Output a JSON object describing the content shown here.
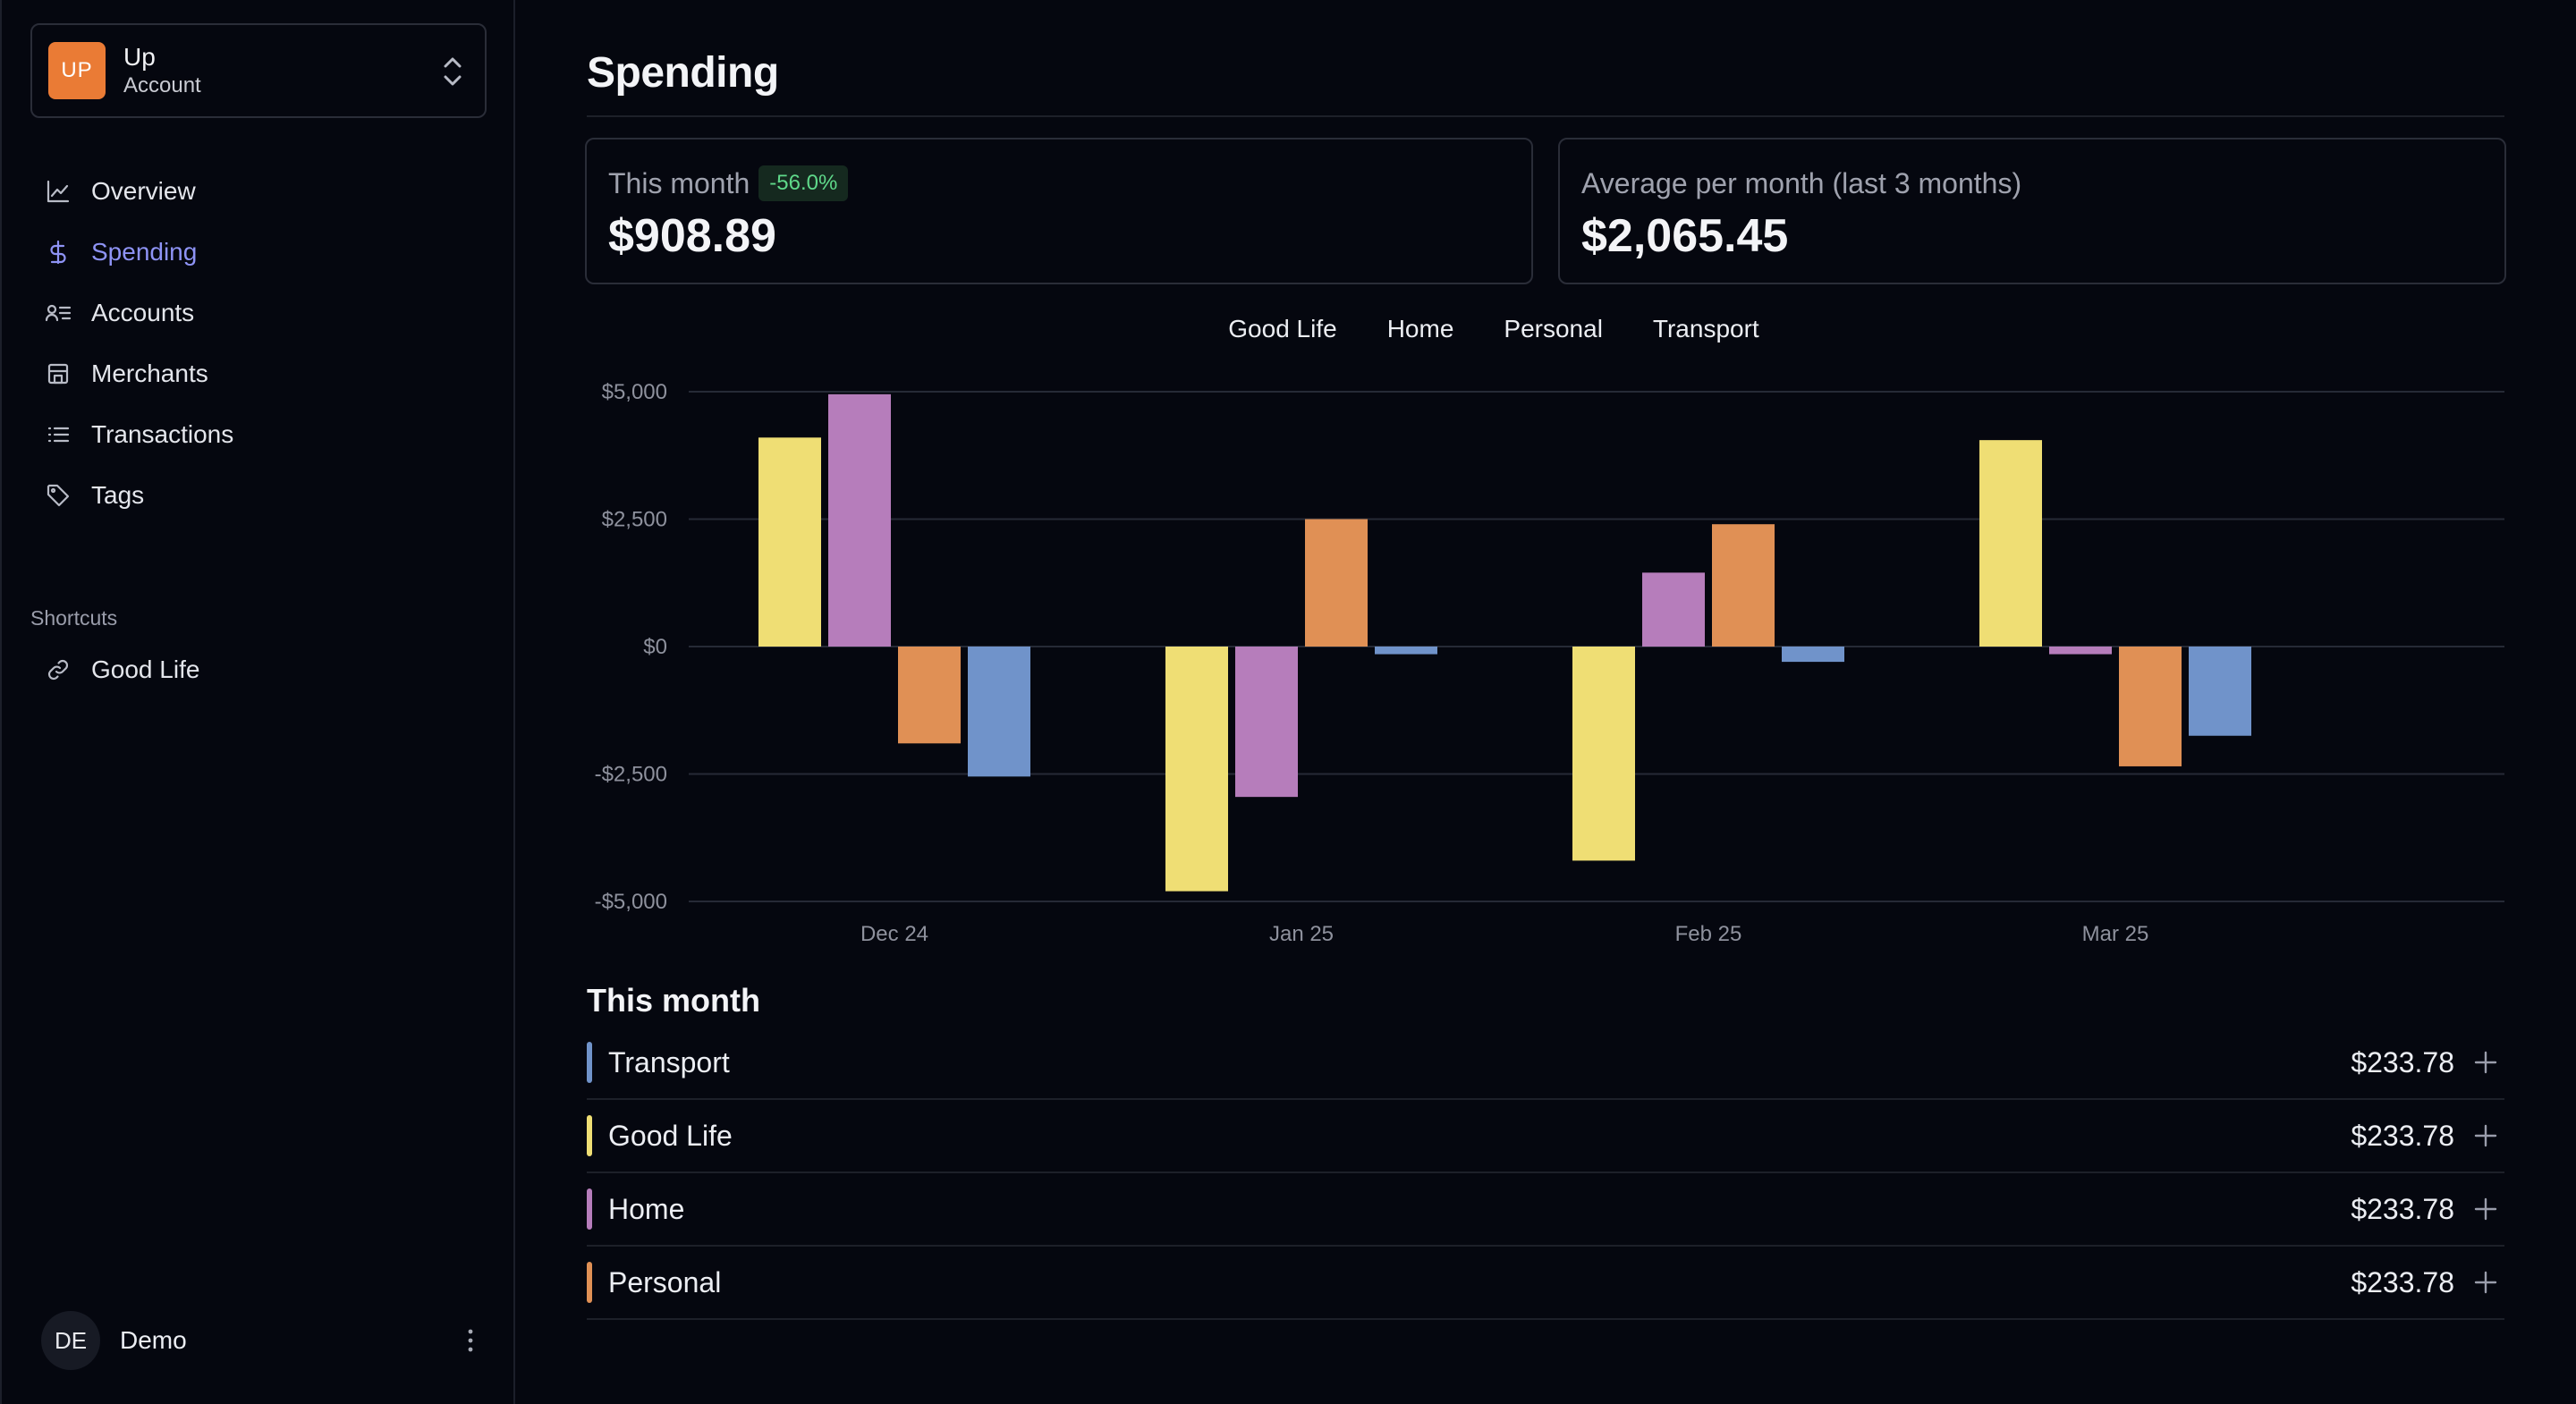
{
  "account": {
    "logo": "UP",
    "name": "Up",
    "subtitle": "Account"
  },
  "nav": [
    {
      "label": "Overview",
      "icon": "chart-line-icon",
      "active": false
    },
    {
      "label": "Spending",
      "icon": "dollar-icon",
      "active": true
    },
    {
      "label": "Accounts",
      "icon": "accounts-icon",
      "active": false
    },
    {
      "label": "Merchants",
      "icon": "store-icon",
      "active": false
    },
    {
      "label": "Transactions",
      "icon": "list-icon",
      "active": false
    },
    {
      "label": "Tags",
      "icon": "tag-icon",
      "active": false
    }
  ],
  "shortcuts": {
    "title": "Shortcuts",
    "items": [
      {
        "label": "Good Life",
        "icon": "link-icon"
      }
    ]
  },
  "user": {
    "initials": "DE",
    "name": "Demo"
  },
  "page": {
    "title": "Spending"
  },
  "stats": {
    "this_month": {
      "label": "This month",
      "badge": "-56.0%",
      "value": "$908.89"
    },
    "average": {
      "label": "Average per month (last 3 months)",
      "value": "$2,065.45"
    }
  },
  "legend": [
    "Good Life",
    "Home",
    "Personal",
    "Transport"
  ],
  "chart_data": {
    "type": "bar",
    "categories": [
      "Dec 24",
      "Jan 25",
      "Feb 25",
      "Mar 25"
    ],
    "series": [
      {
        "name": "Good Life",
        "color": "#efde74",
        "values": [
          4100,
          -4800,
          -4200,
          4050
        ]
      },
      {
        "name": "Home",
        "color": "#b67dbb",
        "values": [
          4950,
          -2950,
          1450,
          -150
        ]
      },
      {
        "name": "Personal",
        "color": "#e09055",
        "values": [
          -1900,
          2500,
          2400,
          -2350
        ]
      },
      {
        "name": "Transport",
        "color": "#7093ca",
        "values": [
          -2550,
          -150,
          -300,
          -1750
        ]
      }
    ],
    "ylim": [
      -5000,
      5000
    ],
    "yticks": [
      5000,
      2500,
      0,
      -2500,
      -5000
    ],
    "ytick_labels": [
      "$5,000",
      "$2,500",
      "$0",
      "-$2,500",
      "-$5,000"
    ],
    "grid": true,
    "legend": "top-center"
  },
  "this_month": {
    "title": "This month",
    "items": [
      {
        "name": "Transport",
        "color": "#7093ca",
        "amount": "$233.78"
      },
      {
        "name": "Good Life",
        "color": "#efde74",
        "amount": "$233.78"
      },
      {
        "name": "Home",
        "color": "#b67dbb",
        "amount": "$233.78"
      },
      {
        "name": "Personal",
        "color": "#e09055",
        "amount": "$233.78"
      }
    ]
  },
  "colors": {
    "accent": "#8e93f5",
    "badge_text": "#5fd98a",
    "logo": "#ea7b35"
  }
}
